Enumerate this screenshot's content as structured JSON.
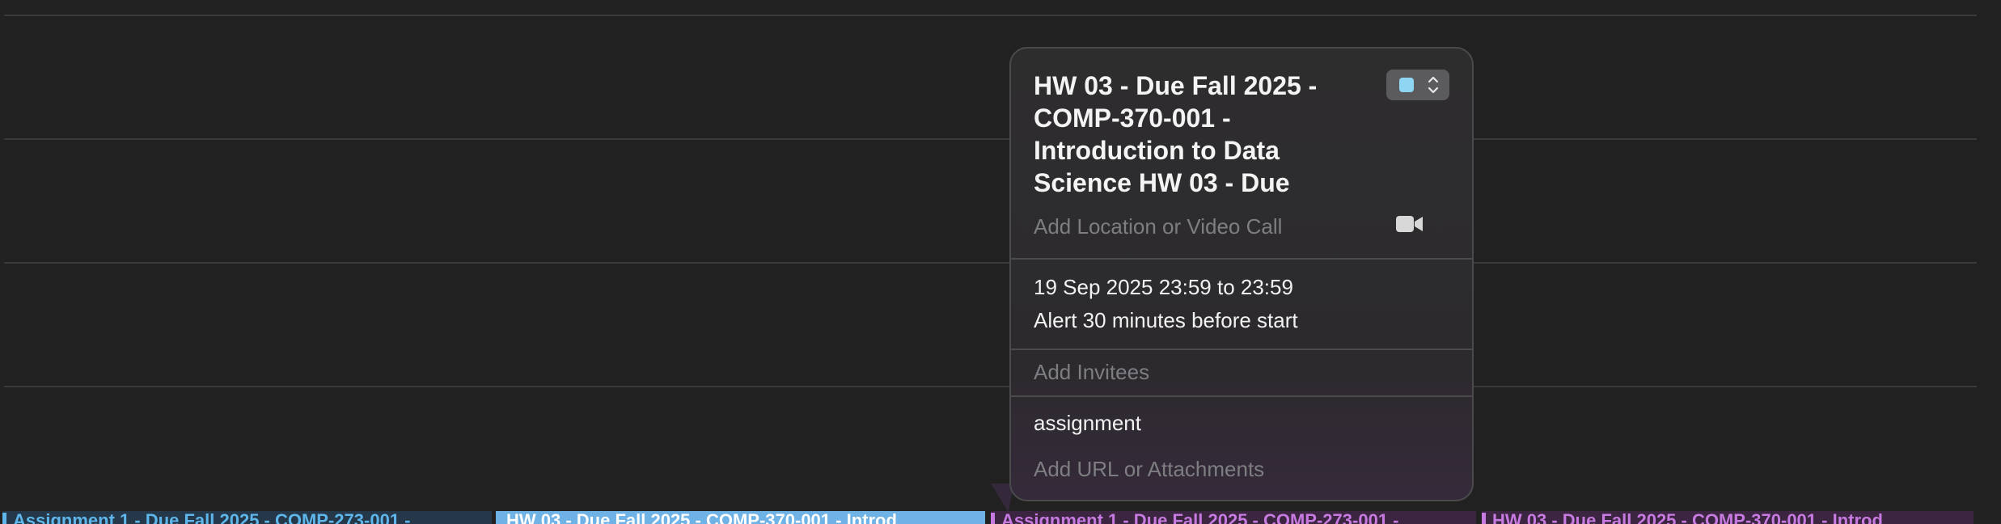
{
  "popover": {
    "title": "HW 03 - Due Fall 2025 -\nCOMP-370-001 -\nIntroduction to Data\nScience HW 03 - Due",
    "calendar_color": "#8fd6f2",
    "location_placeholder": "Add Location or Video Call",
    "video_icon": "video-camera-icon",
    "date_line": "19 Sep 2025  23:59 to 23:59",
    "alert_line": "Alert 30 minutes before start",
    "invitees_placeholder": "Add Invitees",
    "calendar_name": "assignment",
    "url_placeholder": "Add URL or Attachments"
  },
  "events": [
    {
      "label": "Assignment 1 - Due Fall 2025 - COMP-273-001 -",
      "text_color": "#5fb6ea",
      "bg": "#24384a",
      "bar": "#5fb6ea"
    },
    {
      "label": "HW 03 - Due Fall 2025 - COMP-370-001 - Introd",
      "text_color": "#ffffff",
      "bg": "#6fb2e6",
      "bar": "#6fb2e6"
    },
    {
      "label": "Assignment 1 - Due Fall 2025 - COMP-273-001 -",
      "text_color": "#c77ae0",
      "bg": "#3b2540",
      "bar": "#c77ae0"
    },
    {
      "label": "HW 03 - Due Fall 2025 - COMP-370-001 - Introd",
      "text_color": "#c77ae0",
      "bg": "#3b2540",
      "bar": "#c77ae0"
    }
  ]
}
